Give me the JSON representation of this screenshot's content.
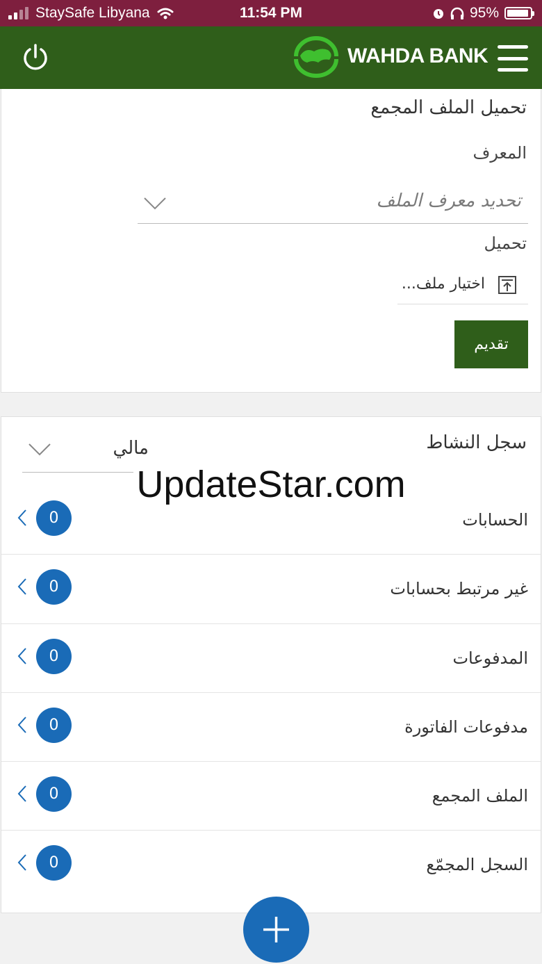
{
  "status_bar": {
    "carrier": "StaySafe Libyana",
    "time": "11:54 PM",
    "battery": "95%"
  },
  "header": {
    "brand": "WAHDA BANK",
    "icons": [
      "power-icon",
      "logo-icon",
      "menu-icon"
    ]
  },
  "upload": {
    "title": "تحميل الملف المجمع",
    "id_label": "المعرف",
    "id_placeholder": "تحديد معرف الملف",
    "upload_label": "تحميل",
    "choose_file": "اختيار ملف...",
    "submit": "تقديم"
  },
  "activity": {
    "title": "سجل النشاط",
    "period": "مالي",
    "rows": [
      {
        "label": "الحسابات",
        "count": "0"
      },
      {
        "label": "غير مرتبط بحسابات",
        "count": "0"
      },
      {
        "label": "المدفوعات",
        "count": "0"
      },
      {
        "label": "مدفوعات الفاتورة",
        "count": "0"
      },
      {
        "label": "الملف المجمع",
        "count": "0"
      },
      {
        "label": "السجل المجمّع",
        "count": "0"
      }
    ]
  },
  "watermark": "UpdateStar.com",
  "colors": {
    "status_bar": "#7e1f3e",
    "header": "#2f5e1a",
    "accent_blue": "#1a6bb7"
  }
}
